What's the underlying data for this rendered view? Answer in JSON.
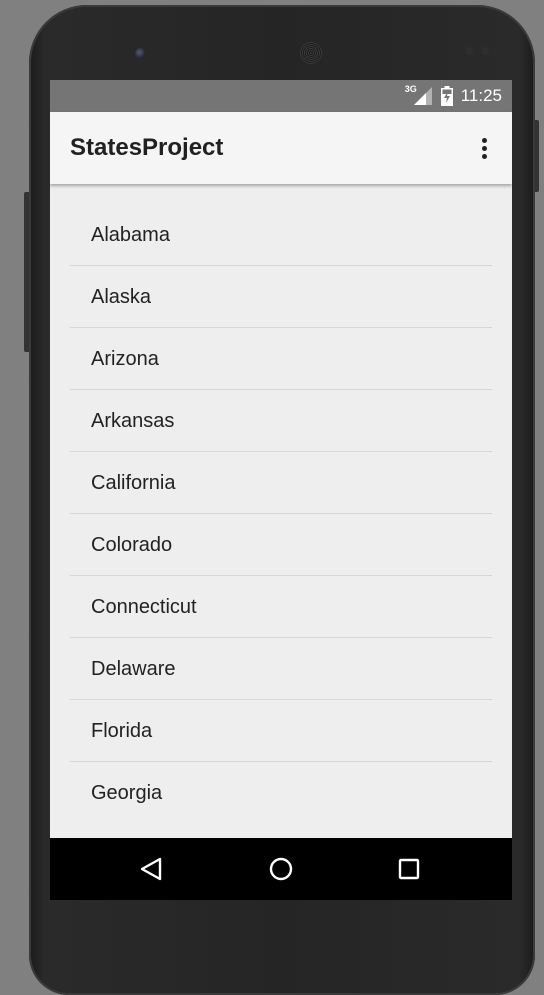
{
  "status_bar": {
    "network_label": "3G",
    "signal_icon": "signal-icon",
    "battery_icon": "battery-icon",
    "time": "11:25"
  },
  "app_bar": {
    "title": "StatesProject",
    "menu_icon": "overflow-menu-icon"
  },
  "states_list": [
    "Alabama",
    "Alaska",
    "Arizona",
    "Arkansas",
    "California",
    "Colorado",
    "Connecticut",
    "Delaware",
    "Florida",
    "Georgia"
  ],
  "nav_bar": {
    "back_icon": "back-icon",
    "home_icon": "home-icon",
    "recents_icon": "recents-icon"
  },
  "colors": {
    "status_bar": "#757575",
    "app_bar": "#f5f5f5",
    "screen_background": "#eeeeee",
    "nav_bar": "#000000"
  }
}
